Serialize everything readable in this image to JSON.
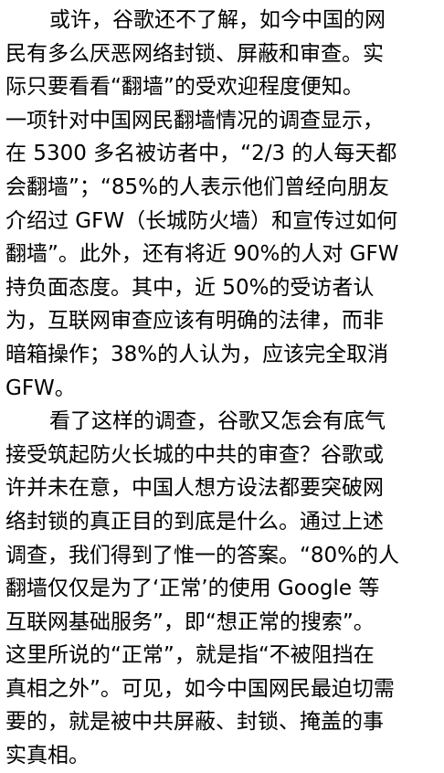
{
  "document": {
    "paragraphs": [
      {
        "lines": [
          "或许，谷歌还不了解，如今中国的网",
          "民有多么厌恶网络封锁、屏蔽和审查。实",
          "际只要看看“翻墙”的受欢迎程度便知。",
          "一项针对中国网民翻墙情况的调查显示，",
          "在 5300 多名被访者中，“2/3 的人每天都",
          "会翻墙”；“85%的人表示他们曾经向朋友",
          "介绍过 GFW（长城防火墙）和宣传过如何",
          "翻墙”。此外，还有将近 90%的人对 GFW",
          "持负面态度。其中，近 50%的受访者认",
          "为，互联网审查应该有明确的法律，而非",
          "暗箱操作；38%的人认为，应该完全取消",
          "GFW。"
        ]
      },
      {
        "lines": [
          "看了这样的调查，谷歌又怎会有底气",
          "接受筑起防火长城的中共的审查？谷歌或",
          "许并未在意，中国人想方设法都要突破网",
          "络封锁的真正目的到底是什么。通过上述",
          "调查，我们得到了惟一的答案。“80%的人",
          "翻墙仅仅是为了‘正常’的使用 Google 等",
          "互联网基础服务”，即“想正常的搜索”。",
          "这里所说的“正常”，就是指“不被阻挡在",
          "真相之外”。可见，如今中国网民最迫切需",
          "要的，就是被中共屏蔽、封锁、掩盖的事",
          "实真相。"
        ]
      }
    ]
  }
}
